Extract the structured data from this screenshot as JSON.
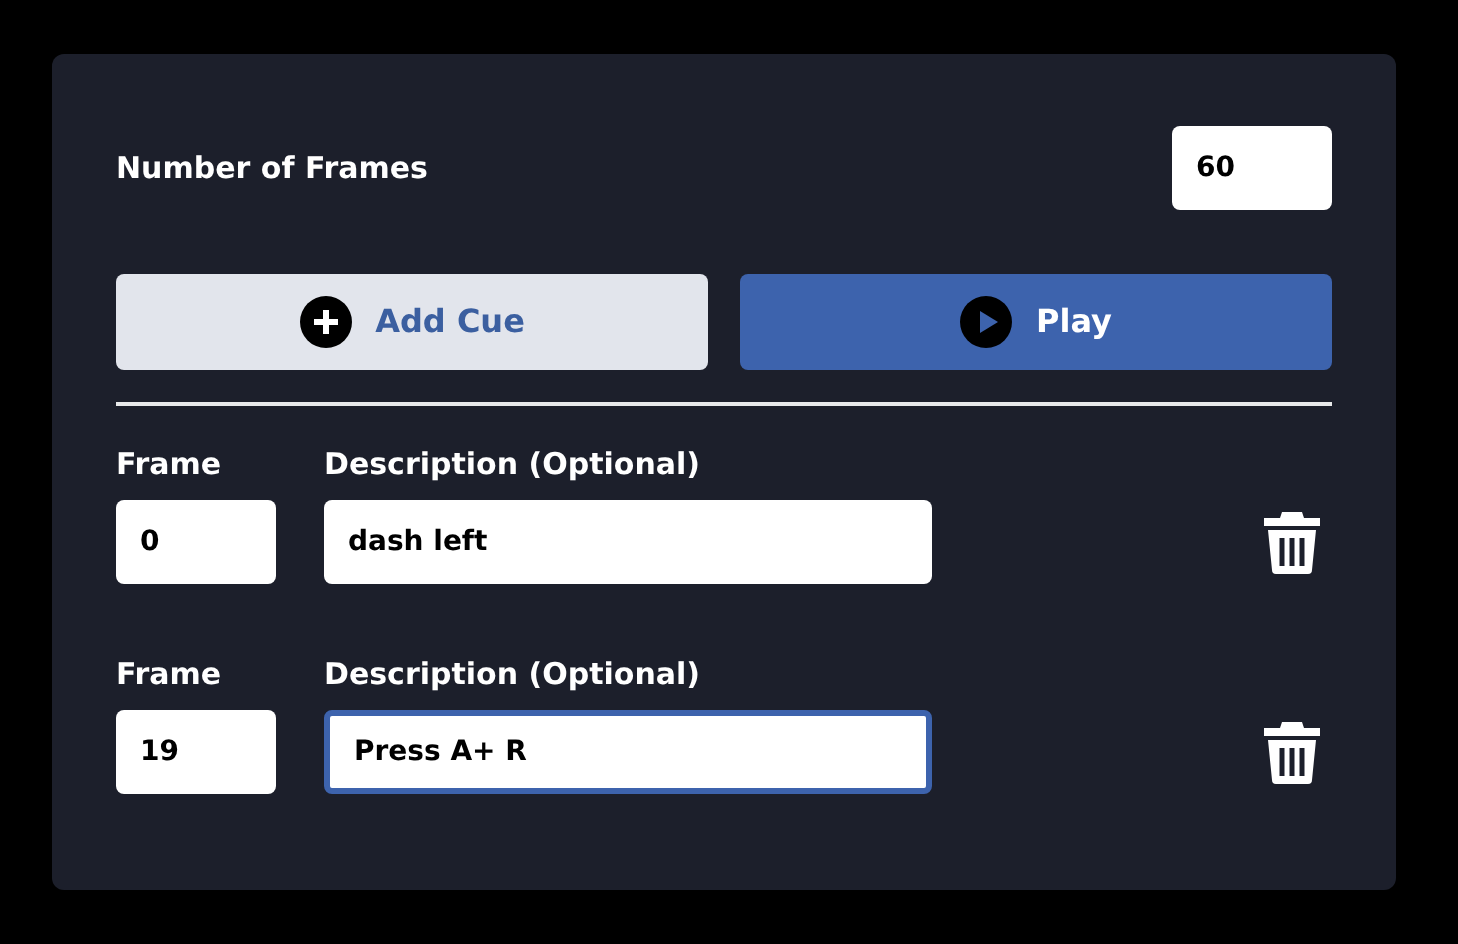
{
  "frames_field": {
    "label": "Number of Frames",
    "value": "60"
  },
  "buttons": [
    {
      "label": "Add Cue",
      "kind": "add"
    },
    {
      "label": "Play",
      "kind": "play"
    }
  ],
  "cues": [
    {
      "frame_label": "Frame",
      "frame": "0",
      "description_label": "Description (Optional)",
      "description": "dash left",
      "focused": false
    },
    {
      "frame_label": "Frame",
      "frame": "19",
      "description_label": "Description (Optional)",
      "description": "Press A+ R",
      "focused": true
    }
  ]
}
